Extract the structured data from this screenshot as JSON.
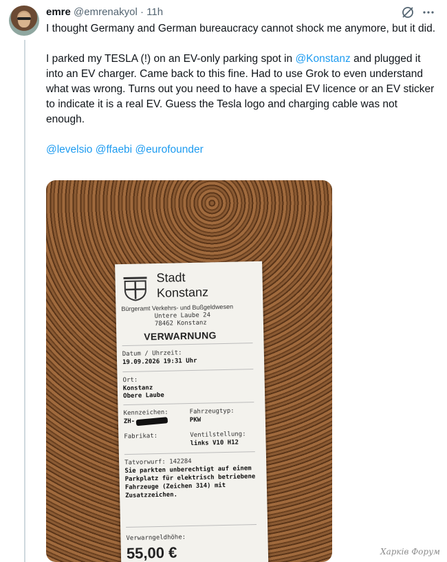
{
  "author": {
    "name": "emre",
    "handle": "@emrenakyol",
    "separator": "·",
    "time": "11h"
  },
  "tweet": {
    "para1": "I thought Germany and German bureaucracy cannot shock me anymore, but it did.",
    "para2_a": "I parked my TESLA (!) on an EV-only parking spot in ",
    "para2_mention": "@Konstanz",
    "para2_b": " and plugged it into an EV charger. Came back to this fine. Had to use Grok to even understand what was wrong. Turns out you need to have a special EV licence or an EV sticker to indicate it is a real EV. Guess the Tesla logo and charging cable was not enough.",
    "mentions": [
      "@levelsio",
      "@ffaebi",
      "@eurofounder"
    ]
  },
  "receipt": {
    "city_1": "Stadt",
    "city_2": "Konstanz",
    "office": "Bürgeramt Verkehrs- und Bußgeldwesen",
    "street": "Untere Laube 24",
    "zip": "78462 Konstanz",
    "title": "VERWARNUNG",
    "date_label": "Datum / Uhrzeit:",
    "date_value": "19.09.2026 19:31 Uhr",
    "place_label": "Ort:",
    "place_1": "Konstanz",
    "place_2": "Obere Laube",
    "plate_label": "Kennzeichen:",
    "plate_value": "ZH-",
    "type_label": "Fahrzeugtyp:",
    "type_value": "PKW",
    "make_label": "Fabrikat:",
    "valve_label": "Ventilstellung:",
    "valve_value": "links V10 H12",
    "offense_label": "Tatvorwurf: 142284",
    "offense_1": "Sie parkten unberechtigt auf einem",
    "offense_2": "Parkplatz für elektrisch betriebene",
    "offense_3": "Fahrzeuge (Zeichen 314) mit",
    "offense_4": "Zusatzzeichen.",
    "amount_label": "Verwarngeldhöhe:",
    "amount": "55,00 €"
  },
  "watermark": "Харків Форум",
  "icons": [
    "avatar",
    "grok-icon",
    "more-icon",
    "konstanz-crest-icon"
  ],
  "colors": {
    "link": "#1d9bf0",
    "secondary": "#536471",
    "text": "#0f1419"
  }
}
